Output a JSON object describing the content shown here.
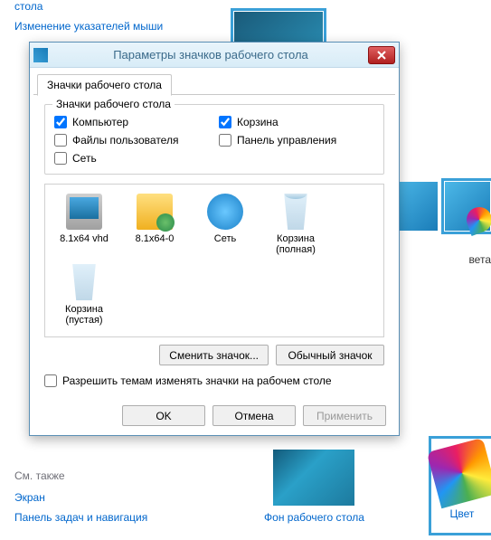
{
  "bg": {
    "nav_partial_1": "стола",
    "nav_2": "Изменение указателей мыши",
    "caption_right": "вета",
    "see_also": "См. также",
    "link_screen": "Экран",
    "link_taskbar": "Панель задач и навигация",
    "bottom_wallpaper": "Фон рабочего стола",
    "bottom_color": "Цвет"
  },
  "dlg": {
    "title": "Параметры значков рабочего стола",
    "tab": "Значки рабочего стола",
    "group_title": "Значки рабочего стола",
    "chk": {
      "computer": "Компьютер",
      "user_files": "Файлы пользователя",
      "network": "Сеть",
      "recycle": "Корзина",
      "control": "Панель управления"
    },
    "checked": {
      "computer": true,
      "user_files": false,
      "network": false,
      "recycle": true,
      "control": false
    },
    "icons": [
      {
        "label": "8.1x64 vhd",
        "kind": "computer"
      },
      {
        "label": "8.1x64-0",
        "kind": "folder"
      },
      {
        "label": "Сеть",
        "kind": "network"
      },
      {
        "label": "Корзина (полная)",
        "kind": "bin-full"
      },
      {
        "label": "Корзина (пустая)",
        "kind": "bin"
      }
    ],
    "btn_change": "Сменить значок...",
    "btn_restore": "Обычный значок",
    "allow_themes": "Разрешить темам изменять значки на рабочем столе",
    "allow_checked": false,
    "ok": "OK",
    "cancel": "Отмена",
    "apply": "Применить"
  }
}
